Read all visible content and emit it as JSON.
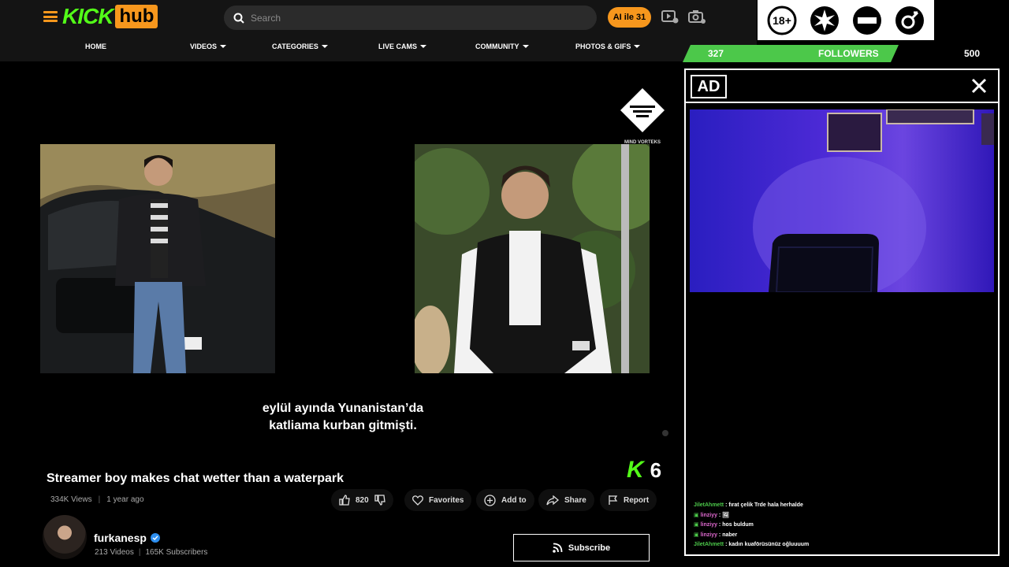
{
  "header": {
    "logo_kick": "KICK",
    "logo_hub": "hub",
    "search_placeholder": "Search",
    "ai_button": "AI ile 31",
    "nav": [
      {
        "label": "HOME",
        "dropdown": false
      },
      {
        "label": "VIDEOS",
        "dropdown": true
      },
      {
        "label": "CATEGORIES",
        "dropdown": true
      },
      {
        "label": "LIVE CAMS",
        "dropdown": true
      },
      {
        "label": "COMMUNITY",
        "dropdown": true
      },
      {
        "label": "PHOTOS & GIFS",
        "dropdown": true
      }
    ],
    "icons": [
      "video-upload-icon",
      "camera-icon"
    ]
  },
  "badges": [
    "18+",
    "explicit-star",
    "no-entry",
    "gender"
  ],
  "followers": {
    "current": "327",
    "label": "FOLLOWERS",
    "goal": "500",
    "progress": 0.654,
    "color": "#4cc84a"
  },
  "ad_panel": {
    "label": "AD",
    "close": "✕"
  },
  "chat": [
    {
      "user": "JiletAhmett",
      "message": "fırat çelik Trde hala herhalde",
      "color": "#4cc84a",
      "icon": false
    },
    {
      "user": "linziyy",
      "message": "",
      "color": "#e06ad0",
      "icon": true
    },
    {
      "user": "linziyy",
      "message": "hos buldum",
      "color": "#e06ad0",
      "icon": true
    },
    {
      "user": "linziyy",
      "message": "naber",
      "color": "#e06ad0",
      "icon": true
    },
    {
      "user": "JiletAhmett",
      "message": "kadın kuaförüsünüz oğluuuum",
      "color": "#4cc84a",
      "icon": false
    }
  ],
  "video": {
    "subtitle_line1": "eylül ayında Yunanistan’da",
    "subtitle_line2": "katliama kurban gitmişti.",
    "watermark": "MIND VORTEKS",
    "kick_counter": "6"
  },
  "info": {
    "title": "Streamer boy makes chat wetter than a waterpark",
    "views": "334K Views",
    "age": "1 year ago",
    "likes": "820",
    "favorites": "Favorites",
    "add_to": "Add to",
    "share": "Share",
    "report": "Report"
  },
  "channel": {
    "name": "furkanesp",
    "videos": "213 Videos",
    "subscribers": "165K Subscribers",
    "subscribe_label": "Subscribe"
  },
  "colors": {
    "kick_green": "#53fc18",
    "hub_orange": "#f7971d",
    "followers_green": "#4cc84a"
  }
}
